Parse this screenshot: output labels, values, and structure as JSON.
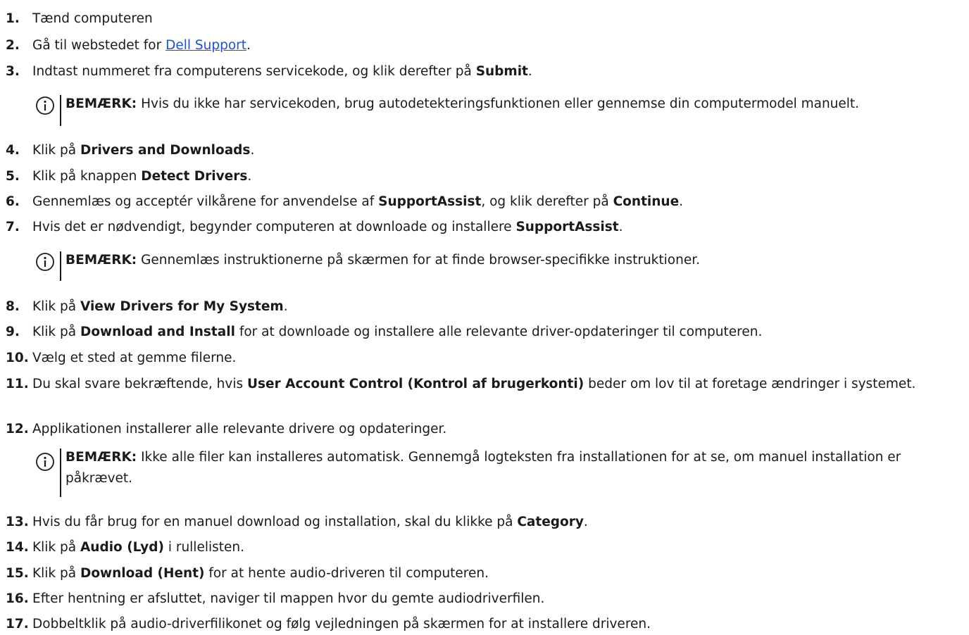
{
  "steps": [
    {
      "num": "1.",
      "t1": "Tænd computeren"
    },
    {
      "num": "2.",
      "t1": "Gå til webstedet for ",
      "link": "Dell Support",
      "t2": "."
    },
    {
      "num": "3.",
      "t1": "Indtast nummeret fra computerens servicekode, og klik derefter på ",
      "b1": "Submit",
      "t2": "."
    },
    {
      "num": "4.",
      "t1": "Klik på ",
      "b1": "Drivers and Downloads",
      "t2": "."
    },
    {
      "num": "5.",
      "t1": "Klik på knappen ",
      "b1": "Detect Drivers",
      "t2": "."
    },
    {
      "num": "6.",
      "t1": "Gennemlæs og acceptér vilkårene for anvendelse af ",
      "b1": "SupportAssist",
      "t2": ", og klik derefter på ",
      "b2": "Continue",
      "t3": "."
    },
    {
      "num": "7.",
      "t1": "Hvis det er nødvendigt, begynder computeren at downloade og installere ",
      "b1": "SupportAssist",
      "t2": "."
    },
    {
      "num": "8.",
      "t1": "Klik på ",
      "b1": "View Drivers for My System",
      "t2": "."
    },
    {
      "num": "9.",
      "t1": "Klik på ",
      "b1": "Download and Install",
      "t2": " for at downloade og installere alle relevante driver-opdateringer til computeren."
    },
    {
      "num": "10.",
      "t1": "Vælg et sted at gemme filerne."
    },
    {
      "num": "11.",
      "t1": "Du skal svare bekræftende, hvis ",
      "b1": "User Account Control (Kontrol af brugerkonti)",
      "t2": " beder om lov til at foretage ændringer i systemet."
    },
    {
      "num": "12.",
      "t1": "Applikationen installerer alle relevante drivere og opdateringer."
    },
    {
      "num": "13.",
      "t1": "Hvis du får brug for en manuel download og installation, skal du klikke på ",
      "b1": "Category",
      "t2": "."
    },
    {
      "num": "14.",
      "t1": "Klik på ",
      "b1": "Audio (Lyd)",
      "t2": " i rullelisten."
    },
    {
      "num": "15.",
      "t1": "Klik på ",
      "b1": "Download (Hent)",
      "t2": " for at hente audio-driveren til computeren."
    },
    {
      "num": "16.",
      "t1": "Efter hentning er afsluttet, naviger til mappen hvor du gemte audiodriverfilen."
    },
    {
      "num": "17.",
      "t1": "Dobbeltklik på audio-driverfilikonet og følg vejledningen på skærmen for at installere driveren."
    }
  ],
  "notes": [
    {
      "label": "BEMÆRK:",
      "text": " Hvis du ikke har servicekoden, brug autodetekteringsfunktionen eller gennemse din computermodel manuelt."
    },
    {
      "label": "BEMÆRK:",
      "text": " Gennemlæs instruktionerne på skærmen for at finde browser-specifikke instruktioner."
    },
    {
      "label": "BEMÆRK:",
      "text": " Ikke alle filer kan installeres automatisk. Gennemgå logteksten fra installationen for at se, om manuel installation er påkrævet."
    }
  ],
  "note_icon": "info-circle-icon",
  "colors": {
    "text": "#1a1a1a",
    "link": "#1f4fd8"
  }
}
